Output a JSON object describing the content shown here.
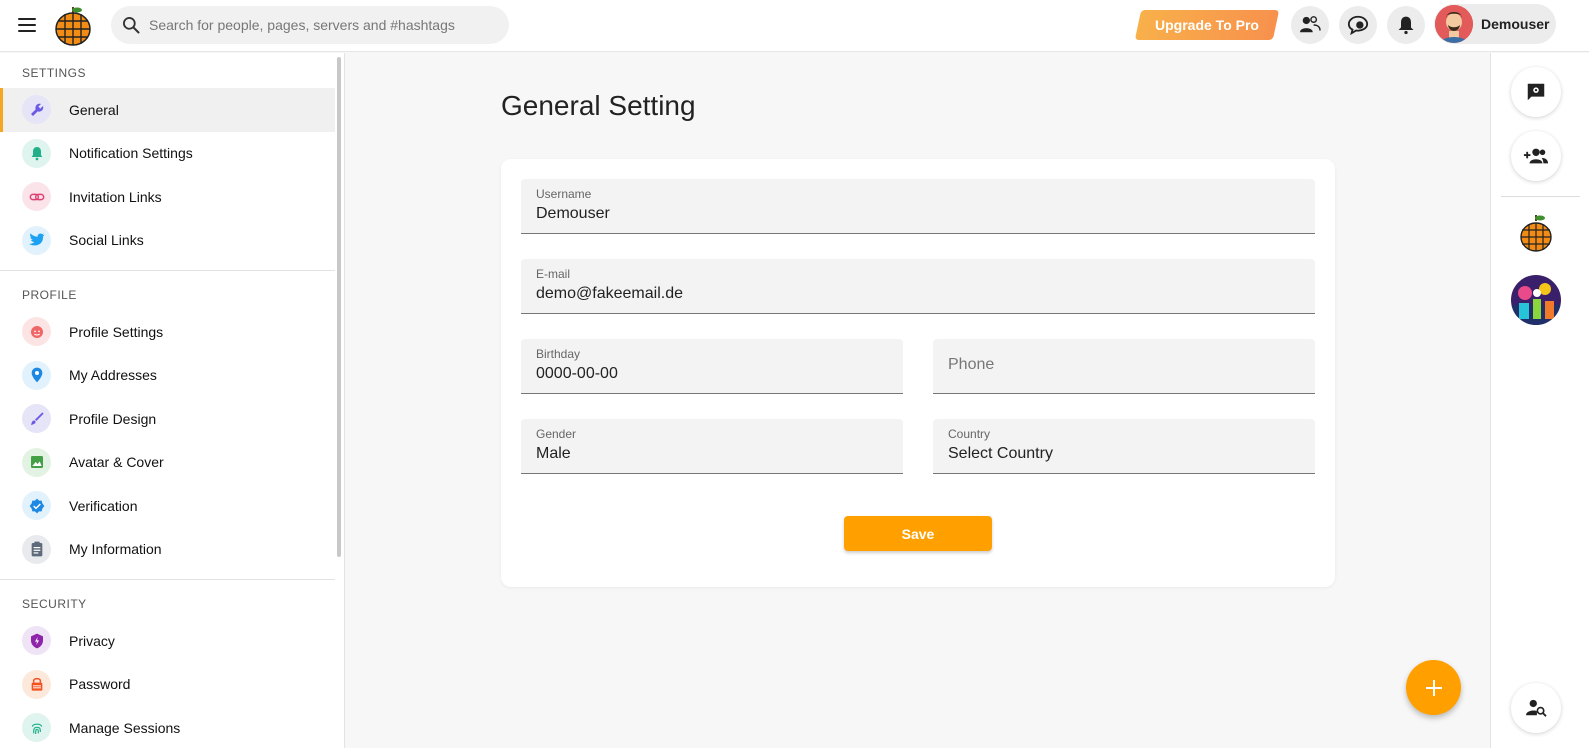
{
  "header": {
    "search_placeholder": "Search for people, pages, servers and #hashtags",
    "upgrade_label": "Upgrade To Pro",
    "username": "Demouser",
    "accent": "#f5a623"
  },
  "sidebar": {
    "sections": [
      {
        "title": "SETTINGS",
        "items": [
          {
            "label": "General",
            "icon": "wrench-icon",
            "active": true
          },
          {
            "label": "Notification Settings",
            "icon": "bell-icon"
          },
          {
            "label": "Invitation Links",
            "icon": "link-icon"
          },
          {
            "label": "Social Links",
            "icon": "twitter-icon"
          }
        ]
      },
      {
        "title": "PROFILE",
        "items": [
          {
            "label": "Profile Settings",
            "icon": "face-icon"
          },
          {
            "label": "My Addresses",
            "icon": "map-pin-icon"
          },
          {
            "label": "Profile Design",
            "icon": "brush-icon"
          },
          {
            "label": "Avatar & Cover",
            "icon": "image-icon"
          },
          {
            "label": "Verification",
            "icon": "verified-badge-icon"
          },
          {
            "label": "My Information",
            "icon": "clipboard-icon"
          }
        ]
      },
      {
        "title": "SECURITY",
        "items": [
          {
            "label": "Privacy",
            "icon": "shield-icon"
          },
          {
            "label": "Password",
            "icon": "lock-icon"
          },
          {
            "label": "Manage Sessions",
            "icon": "fingerprint-icon"
          }
        ]
      }
    ]
  },
  "main": {
    "title": "General Setting",
    "fields": {
      "username": {
        "label": "Username",
        "value": "Demouser"
      },
      "email": {
        "label": "E-mail",
        "value": "demo@fakeemail.de"
      },
      "birthday": {
        "label": "Birthday",
        "value": "0000-00-00"
      },
      "phone": {
        "placeholder": "Phone"
      },
      "gender": {
        "label": "Gender",
        "value": "Male"
      },
      "country": {
        "label": "Country",
        "value": "Select Country"
      }
    },
    "save_label": "Save",
    "save_color": "#ffa000"
  }
}
